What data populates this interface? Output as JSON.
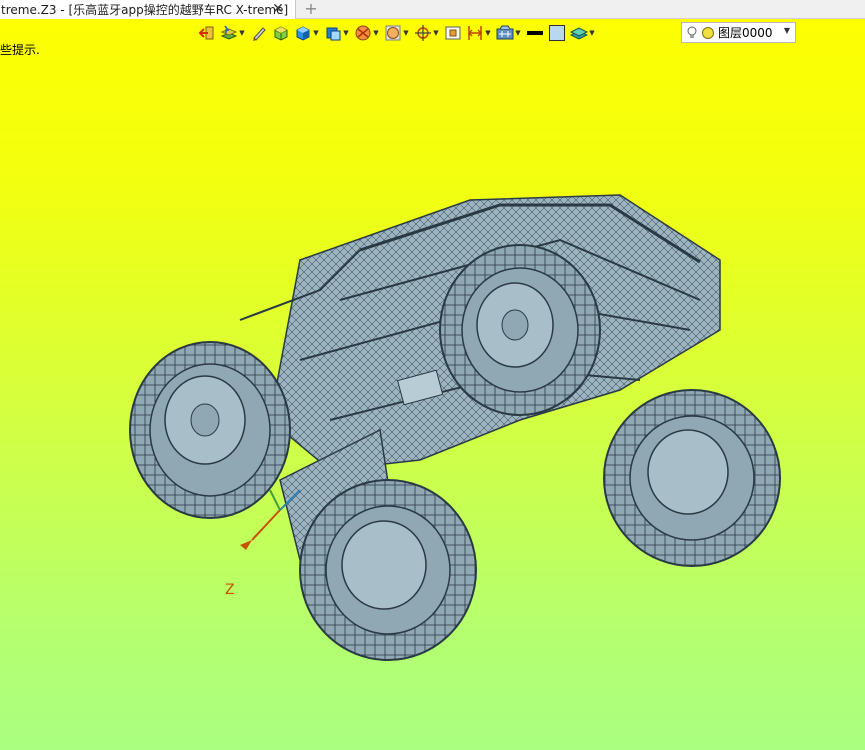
{
  "tab": {
    "title": "treme.Z3 - [乐高蓝牙app操控的越野车RC X-treme]",
    "close_glyph": "✕",
    "add_glyph": "+"
  },
  "toolbar": {
    "buttons": [
      {
        "name": "exit-sketch-icon"
      },
      {
        "name": "layer-stack-icon",
        "dropdown": true
      },
      {
        "name": "pen-tool-icon"
      },
      {
        "name": "render-mode-icon"
      },
      {
        "name": "shaded-cube-icon",
        "dropdown": true
      },
      {
        "name": "view-cube-icon",
        "dropdown": true
      },
      {
        "name": "section-view-icon",
        "dropdown": true
      },
      {
        "name": "globe-view-icon",
        "dropdown": true
      },
      {
        "name": "target-icon",
        "dropdown": true
      },
      {
        "name": "fit-view-icon"
      },
      {
        "name": "align-icon",
        "dropdown": true
      },
      {
        "name": "display-settings-icon",
        "dropdown": true
      },
      {
        "name": "line-color-icon"
      },
      {
        "name": "fill-color-icon"
      },
      {
        "name": "layer-panel-icon",
        "dropdown": true
      }
    ],
    "dropdown_glyph": "▼"
  },
  "layer_select": {
    "value": "图层0000",
    "arrow": "▼"
  },
  "hint": {
    "text": "些提示."
  },
  "viewport": {
    "axis_label": "Z"
  },
  "colors": {
    "bg_top": "#ffff00",
    "bg_bottom": "#aaff80",
    "model_fill": "#8fa8b4",
    "model_stroke": "#2a3a44"
  }
}
